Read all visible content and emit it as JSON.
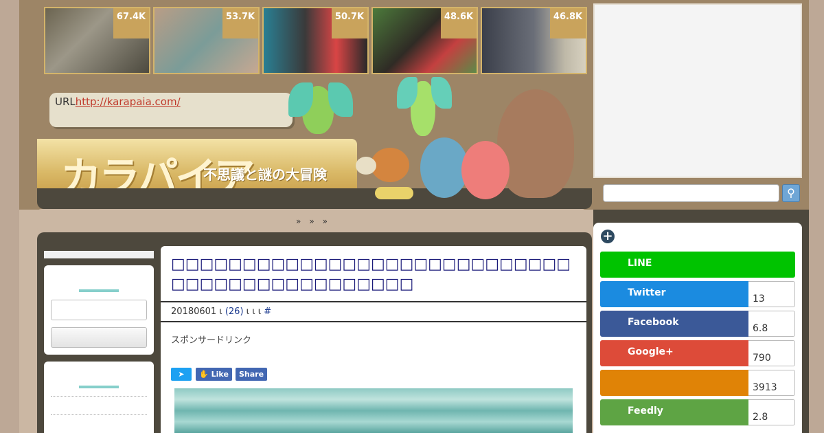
{
  "thumbs": [
    {
      "count": "67.4K",
      "icon": "photo-dragonfly-lab"
    },
    {
      "count": "53.7K",
      "icon": "photo-surgery"
    },
    {
      "count": "50.7K",
      "icon": "photo-makita-coffee"
    },
    {
      "count": "48.6K",
      "icon": "photo-couple"
    },
    {
      "count": "46.8K",
      "icon": "photo-crowd-stairs"
    }
  ],
  "header": {
    "url_prefix": "URL",
    "url": "http://karapaia.com/",
    "logo": "カラパイア",
    "tagline": "不思議と謎の大冒険"
  },
  "nav": {
    "text": "»　»　»"
  },
  "article": {
    "title": "□□□□□□□□□□□□□□□□□□□□□□□□□□□□□□□□□□□□□□□□□□□□□",
    "meta_date": "20180601 ι",
    "meta_comments": "(26)",
    "meta_tail": " ι ι ι ",
    "meta_hash": "#",
    "sponsor": "スポンサードリンク",
    "btn_twitter": "",
    "btn_like": "Like",
    "btn_share": "Share"
  },
  "share": [
    {
      "label": "LINE",
      "count": "",
      "color": "#00c300"
    },
    {
      "label": "Twitter",
      "count": "13",
      "color": "#1b8be0"
    },
    {
      "label": "Facebook",
      "count": "6.8",
      "color": "#3b5998"
    },
    {
      "label": "Google+",
      "count": "790",
      "color": "#dd4b39"
    },
    {
      "label": "",
      "count": "3913",
      "color": "#e08306"
    },
    {
      "label": "Feedly",
      "count": "2.8",
      "color": "#5ea444"
    }
  ],
  "colors": {
    "accent": "#86cfcb",
    "title": "#1b1b7a",
    "header_bg": "#9d8566",
    "dark": "#4d483d"
  }
}
